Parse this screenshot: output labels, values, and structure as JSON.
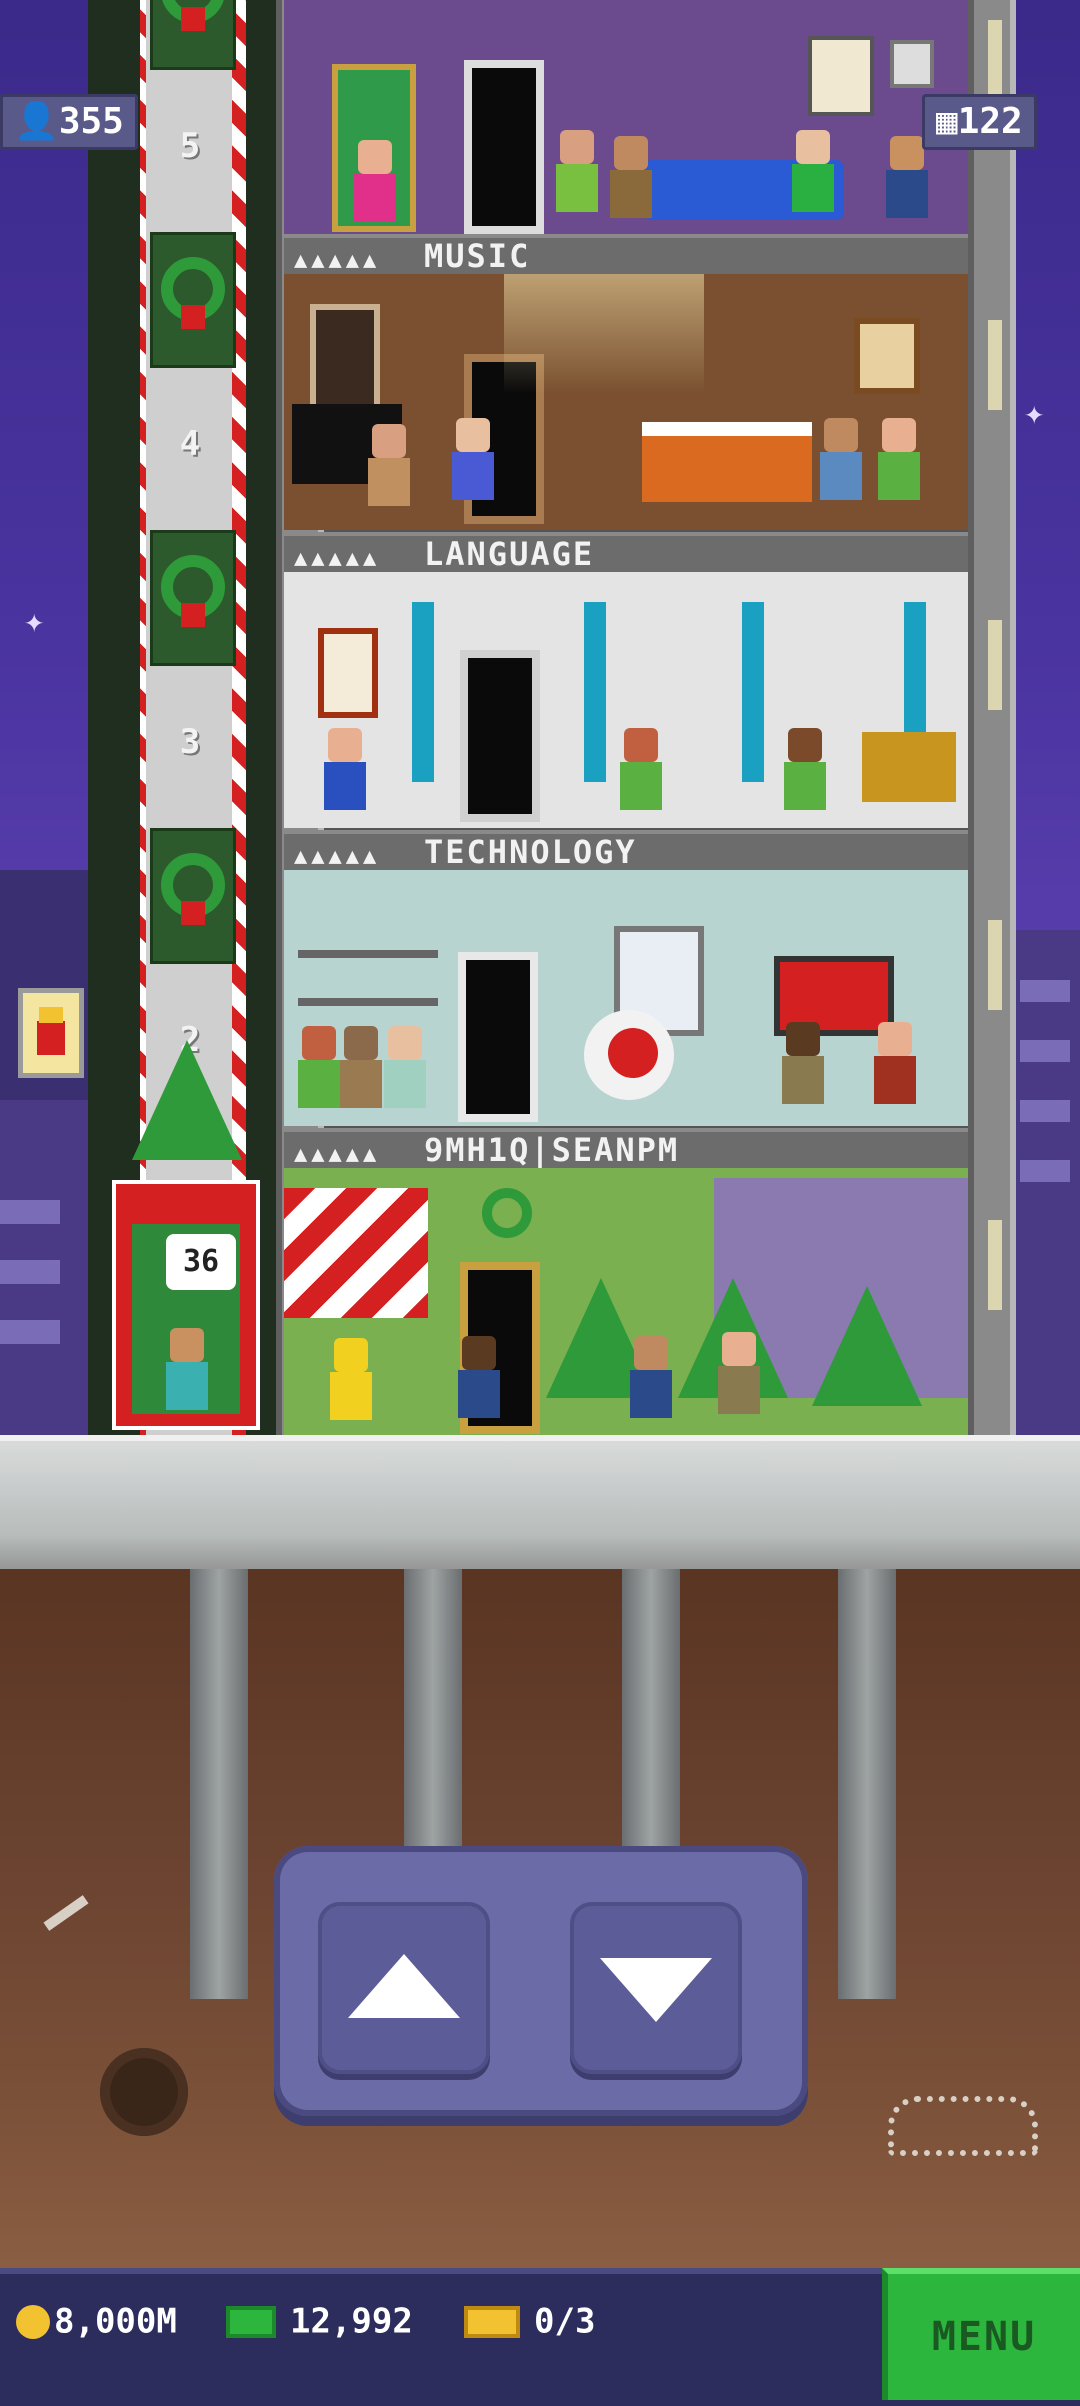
{
  "hud": {
    "population": "355",
    "floors": "122"
  },
  "elevator": {
    "floor_labels": [
      "5",
      "4",
      "3",
      "2"
    ],
    "car_display": "36"
  },
  "floors": [
    {
      "name": "MUSIC",
      "stars": "▲▲▲▲▲"
    },
    {
      "name": "LANGUAGE",
      "stars": "▲▲▲▲▲"
    },
    {
      "name": "TECHNOLOGY",
      "stars": "▲▲▲▲▲"
    },
    {
      "name": "9MH1Q|SEANPM",
      "stars": "▲▲▲▲▲"
    }
  ],
  "bottom": {
    "coins": "8,000M",
    "bux": "12,992",
    "tickets": "0/3",
    "menu_label": "MENU"
  },
  "controls": {
    "up_icon": "arrow-up-icon",
    "down_icon": "arrow-down-icon"
  },
  "colors": {
    "menu_green": "#2db63e",
    "sky": "#4a34a0"
  }
}
